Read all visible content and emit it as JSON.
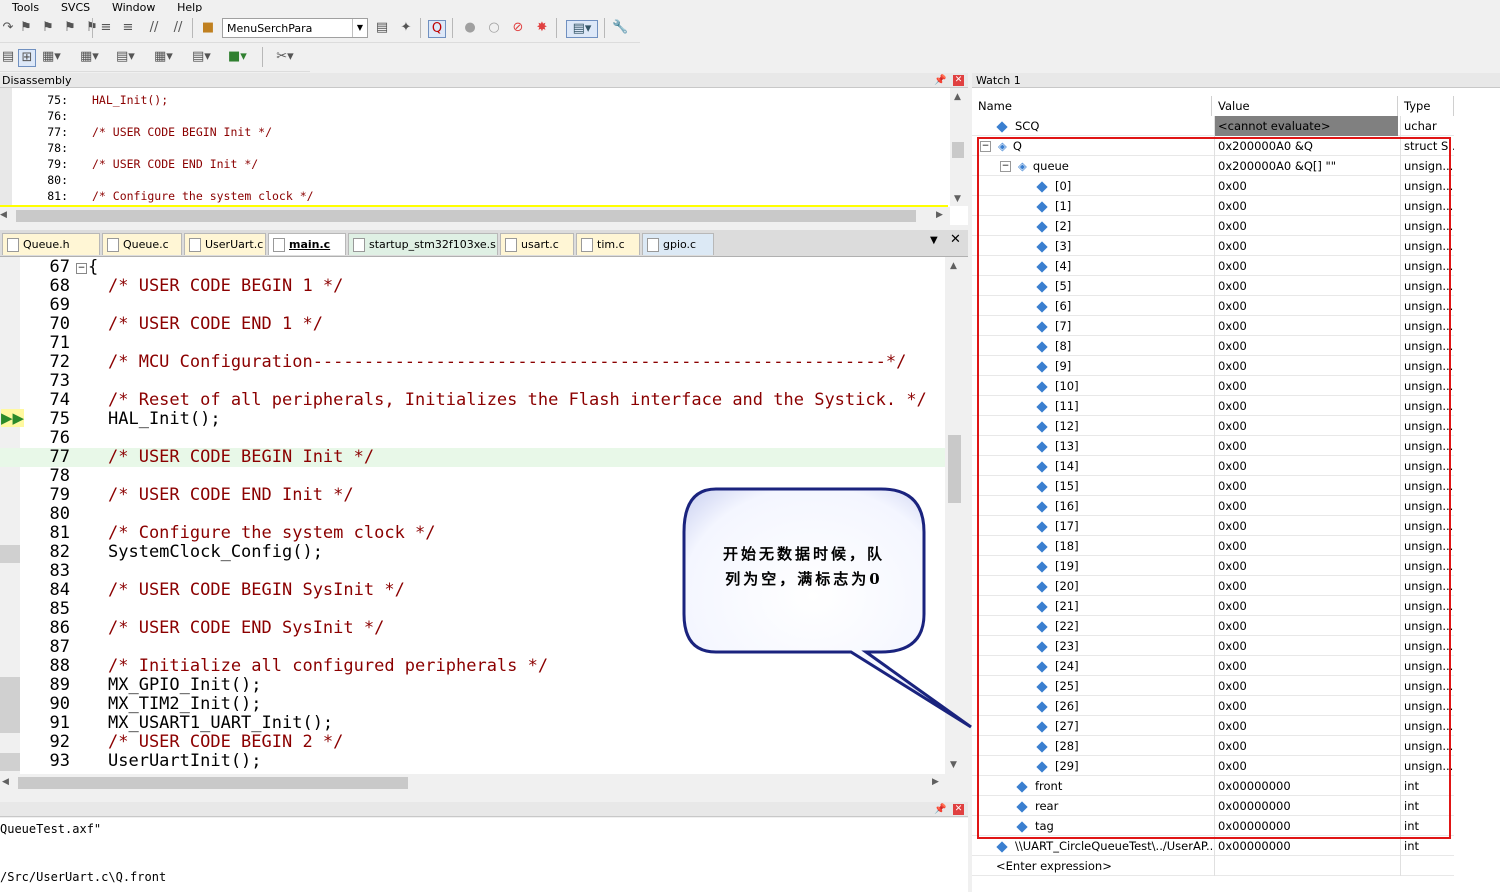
{
  "menu": [
    "Tools",
    "SVCS",
    "Window",
    "Help"
  ],
  "toolbar": {
    "combo_value": "MenuSerchPara"
  },
  "disassembly": {
    "title": "Disassembly",
    "lines": [
      {
        "num": "75:",
        "code": "HAL_Init();"
      },
      {
        "num": "76:",
        "code": ""
      },
      {
        "num": "77:",
        "code": "/* USER CODE BEGIN Init */"
      },
      {
        "num": "78:",
        "code": ""
      },
      {
        "num": "79:",
        "code": "/* USER CODE END Init */"
      },
      {
        "num": "80:",
        "code": ""
      },
      {
        "num": "81:",
        "code": "/* Configure the system clock */"
      }
    ]
  },
  "tabs": [
    {
      "label": "Queue.h",
      "kind": "yellow"
    },
    {
      "label": "Queue.c",
      "kind": "yellow"
    },
    {
      "label": "UserUart.c",
      "kind": "yellow"
    },
    {
      "label": "main.c",
      "kind": "active"
    },
    {
      "label": "startup_stm32f103xe.s",
      "kind": "green"
    },
    {
      "label": "usart.c",
      "kind": "yellow"
    },
    {
      "label": "tim.c",
      "kind": "yellow"
    },
    {
      "label": "gpio.c",
      "kind": "blue"
    }
  ],
  "editor": {
    "lines": [
      {
        "num": "67",
        "code": "{",
        "cm": false
      },
      {
        "num": "68",
        "code": "/* USER CODE BEGIN 1 */",
        "cm": true
      },
      {
        "num": "69",
        "code": "",
        "cm": false
      },
      {
        "num": "70",
        "code": "/* USER CODE END 1 */",
        "cm": true
      },
      {
        "num": "71",
        "code": "",
        "cm": false
      },
      {
        "num": "72",
        "code": "/* MCU Configuration--------------------------------------------------------*/",
        "cm": true
      },
      {
        "num": "73",
        "code": "",
        "cm": false
      },
      {
        "num": "74",
        "code": "/* Reset of all peripherals, Initializes the Flash interface and the Systick. */",
        "cm": true
      },
      {
        "num": "75",
        "code": "HAL_Init();",
        "cm": false
      },
      {
        "num": "76",
        "code": "",
        "cm": false
      },
      {
        "num": "77",
        "code": "/* USER CODE BEGIN Init */",
        "cm": true
      },
      {
        "num": "78",
        "code": "",
        "cm": false
      },
      {
        "num": "79",
        "code": "/* USER CODE END Init */",
        "cm": true
      },
      {
        "num": "80",
        "code": "",
        "cm": false
      },
      {
        "num": "81",
        "code": "/* Configure the system clock */",
        "cm": true
      },
      {
        "num": "82",
        "code": "SystemClock_Config();",
        "cm": false
      },
      {
        "num": "83",
        "code": "",
        "cm": false
      },
      {
        "num": "84",
        "code": "/* USER CODE BEGIN SysInit */",
        "cm": true
      },
      {
        "num": "85",
        "code": "",
        "cm": false
      },
      {
        "num": "86",
        "code": "/* USER CODE END SysInit */",
        "cm": true
      },
      {
        "num": "87",
        "code": "",
        "cm": false
      },
      {
        "num": "88",
        "code": "/* Initialize all configured peripherals */",
        "cm": true
      },
      {
        "num": "89",
        "code": "MX_GPIO_Init();",
        "cm": false
      },
      {
        "num": "90",
        "code": "MX_TIM2_Init();",
        "cm": false
      },
      {
        "num": "91",
        "code": "MX_USART1_UART_Init();",
        "cm": false
      },
      {
        "num": "92",
        "code": "/* USER CODE BEGIN 2 */",
        "cm": true
      },
      {
        "num": "93",
        "code": "UserUartInit();",
        "cm": false
      }
    ]
  },
  "output": {
    "lines": [
      "QueueTest.axf\"",
      "",
      "/Src/UserUart.c\\Q.front"
    ]
  },
  "watch": {
    "title": "Watch 1",
    "headers": {
      "name": "Name",
      "value": "Value",
      "type": "Type"
    },
    "rows": [
      {
        "name": "SCQ",
        "value": "<cannot evaluate>",
        "type": "uchar",
        "level": 0,
        "expander": "",
        "icon": "gem"
      },
      {
        "name": "Q",
        "value": "0x200000A0 &Q",
        "type": "struct S...",
        "level": 0,
        "expander": "−",
        "icon": "struct"
      },
      {
        "name": "queue",
        "value": "0x200000A0 &Q[] \"\"",
        "type": "unsign...",
        "level": 1,
        "expander": "−",
        "icon": "struct"
      },
      {
        "name": "[0]",
        "value": "0x00",
        "type": "unsign...",
        "level": 2,
        "expander": "",
        "icon": "gem"
      },
      {
        "name": "[1]",
        "value": "0x00",
        "type": "unsign...",
        "level": 2,
        "expander": "",
        "icon": "gem"
      },
      {
        "name": "[2]",
        "value": "0x00",
        "type": "unsign...",
        "level": 2,
        "expander": "",
        "icon": "gem"
      },
      {
        "name": "[3]",
        "value": "0x00",
        "type": "unsign...",
        "level": 2,
        "expander": "",
        "icon": "gem"
      },
      {
        "name": "[4]",
        "value": "0x00",
        "type": "unsign...",
        "level": 2,
        "expander": "",
        "icon": "gem"
      },
      {
        "name": "[5]",
        "value": "0x00",
        "type": "unsign...",
        "level": 2,
        "expander": "",
        "icon": "gem"
      },
      {
        "name": "[6]",
        "value": "0x00",
        "type": "unsign...",
        "level": 2,
        "expander": "",
        "icon": "gem"
      },
      {
        "name": "[7]",
        "value": "0x00",
        "type": "unsign...",
        "level": 2,
        "expander": "",
        "icon": "gem"
      },
      {
        "name": "[8]",
        "value": "0x00",
        "type": "unsign...",
        "level": 2,
        "expander": "",
        "icon": "gem"
      },
      {
        "name": "[9]",
        "value": "0x00",
        "type": "unsign...",
        "level": 2,
        "expander": "",
        "icon": "gem"
      },
      {
        "name": "[10]",
        "value": "0x00",
        "type": "unsign...",
        "level": 2,
        "expander": "",
        "icon": "gem"
      },
      {
        "name": "[11]",
        "value": "0x00",
        "type": "unsign...",
        "level": 2,
        "expander": "",
        "icon": "gem"
      },
      {
        "name": "[12]",
        "value": "0x00",
        "type": "unsign...",
        "level": 2,
        "expander": "",
        "icon": "gem"
      },
      {
        "name": "[13]",
        "value": "0x00",
        "type": "unsign...",
        "level": 2,
        "expander": "",
        "icon": "gem"
      },
      {
        "name": "[14]",
        "value": "0x00",
        "type": "unsign...",
        "level": 2,
        "expander": "",
        "icon": "gem"
      },
      {
        "name": "[15]",
        "value": "0x00",
        "type": "unsign...",
        "level": 2,
        "expander": "",
        "icon": "gem"
      },
      {
        "name": "[16]",
        "value": "0x00",
        "type": "unsign...",
        "level": 2,
        "expander": "",
        "icon": "gem"
      },
      {
        "name": "[17]",
        "value": "0x00",
        "type": "unsign...",
        "level": 2,
        "expander": "",
        "icon": "gem"
      },
      {
        "name": "[18]",
        "value": "0x00",
        "type": "unsign...",
        "level": 2,
        "expander": "",
        "icon": "gem"
      },
      {
        "name": "[19]",
        "value": "0x00",
        "type": "unsign...",
        "level": 2,
        "expander": "",
        "icon": "gem"
      },
      {
        "name": "[20]",
        "value": "0x00",
        "type": "unsign...",
        "level": 2,
        "expander": "",
        "icon": "gem"
      },
      {
        "name": "[21]",
        "value": "0x00",
        "type": "unsign...",
        "level": 2,
        "expander": "",
        "icon": "gem"
      },
      {
        "name": "[22]",
        "value": "0x00",
        "type": "unsign...",
        "level": 2,
        "expander": "",
        "icon": "gem"
      },
      {
        "name": "[23]",
        "value": "0x00",
        "type": "unsign...",
        "level": 2,
        "expander": "",
        "icon": "gem"
      },
      {
        "name": "[24]",
        "value": "0x00",
        "type": "unsign...",
        "level": 2,
        "expander": "",
        "icon": "gem"
      },
      {
        "name": "[25]",
        "value": "0x00",
        "type": "unsign...",
        "level": 2,
        "expander": "",
        "icon": "gem"
      },
      {
        "name": "[26]",
        "value": "0x00",
        "type": "unsign...",
        "level": 2,
        "expander": "",
        "icon": "gem"
      },
      {
        "name": "[27]",
        "value": "0x00",
        "type": "unsign...",
        "level": 2,
        "expander": "",
        "icon": "gem"
      },
      {
        "name": "[28]",
        "value": "0x00",
        "type": "unsign...",
        "level": 2,
        "expander": "",
        "icon": "gem"
      },
      {
        "name": "[29]",
        "value": "0x00",
        "type": "unsign...",
        "level": 2,
        "expander": "",
        "icon": "gem"
      },
      {
        "name": "front",
        "value": "0x00000000",
        "type": "int",
        "level": 1,
        "expander": "",
        "icon": "gem"
      },
      {
        "name": "rear",
        "value": "0x00000000",
        "type": "int",
        "level": 1,
        "expander": "",
        "icon": "gem"
      },
      {
        "name": "tag",
        "value": "0x00000000",
        "type": "int",
        "level": 1,
        "expander": "",
        "icon": "gem"
      },
      {
        "name": "\\\\UART_CircleQueueTest\\../UserAP...",
        "value": "0x00000000",
        "type": "int",
        "level": 0,
        "expander": "",
        "icon": "gem"
      },
      {
        "name": "<Enter expression>",
        "value": "",
        "type": "",
        "level": 0,
        "expander": "",
        "icon": "none"
      }
    ]
  },
  "callout": {
    "line1": "开始无数据时候，队",
    "line2": "列为空，满标志为0"
  },
  "colors": {
    "redbox": "#e01515",
    "callout_border": "#1a237e",
    "highlight_line": "#e8f8e8"
  }
}
